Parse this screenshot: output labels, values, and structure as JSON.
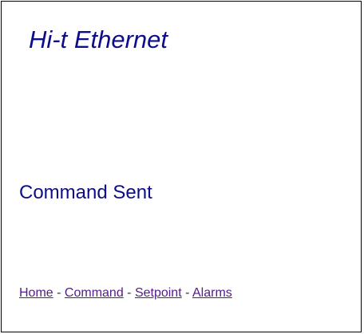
{
  "page": {
    "title": "Hi-t Ethernet",
    "message": "Command Sent"
  },
  "nav": {
    "links": [
      {
        "label": "Home"
      },
      {
        "label": "Command"
      },
      {
        "label": "Setpoint"
      },
      {
        "label": "Alarms"
      }
    ],
    "separator": " - "
  },
  "colors": {
    "heading": "#0d0d8c",
    "link": "#551a8b",
    "border": "#000000",
    "background": "#ffffff"
  }
}
